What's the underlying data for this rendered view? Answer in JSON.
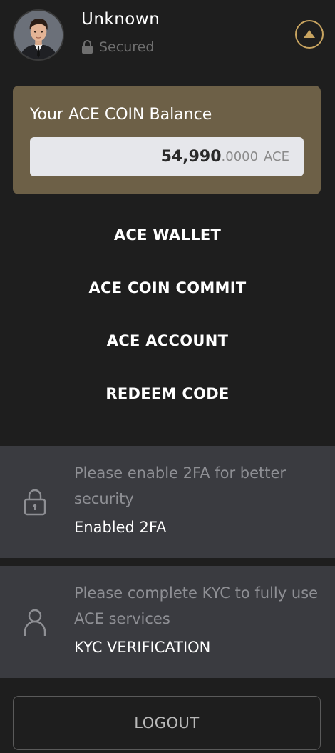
{
  "header": {
    "avatar_alt": "profile avatar",
    "username": "Unknown",
    "security_status": "Secured",
    "collapse_icon": "chevron-up-icon"
  },
  "balance": {
    "title": "Your ACE COIN Balance",
    "integer_part": "54,990",
    "decimal_part": ".0000",
    "unit": "ACE"
  },
  "menu": {
    "items": [
      {
        "label": "ACE WALLET"
      },
      {
        "label": "ACE COIN COMMIT"
      },
      {
        "label": "ACE ACCOUNT"
      },
      {
        "label": "REDEEM CODE"
      }
    ]
  },
  "notices": [
    {
      "icon": "lock-icon",
      "message": "Please enable 2FA for better security",
      "action": "Enabled 2FA"
    },
    {
      "icon": "user-icon",
      "message": "Please complete KYC to fully use ACE services",
      "action": "KYC VERIFICATION"
    }
  ],
  "logout_label": "LOGOUT",
  "colors": {
    "background": "#1e1e1e",
    "balance_card": "#6d6047",
    "accent_gold": "#c8a460",
    "notice_bg": "#3a3b40",
    "muted_text": "#8e8f94"
  }
}
